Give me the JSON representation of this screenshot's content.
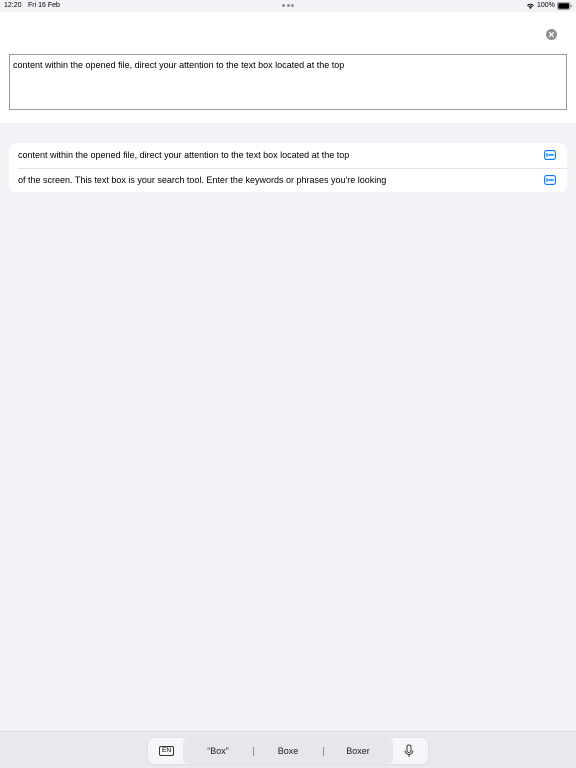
{
  "status_bar": {
    "time": "12:20",
    "date": "Fri 16 Feb",
    "battery": "100%",
    "icons": [
      "multitasking-dots-icon",
      "wifi-icon",
      "battery-icon"
    ]
  },
  "search": {
    "value": "content within the opened file, direct your attention to the text box located at the top",
    "clear_icon": "close-circle-icon"
  },
  "results": [
    {
      "text": "content within the opened file, direct your attention to the text box located at the top",
      "icon": "text-line-icon"
    },
    {
      "text": "of the screen. This text box is your search tool. Enter the keywords or phrases you're looking",
      "icon": "text-line-icon"
    }
  ],
  "keyboard": {
    "language": "EN",
    "suggestions": [
      "“Box”",
      "Boxe",
      "Boxer"
    ],
    "mic_icon": "microphone-icon"
  },
  "colors": {
    "background": "#f2f2f7",
    "accent": "#007aff",
    "keyboard_bar": "#e9e9ee"
  }
}
